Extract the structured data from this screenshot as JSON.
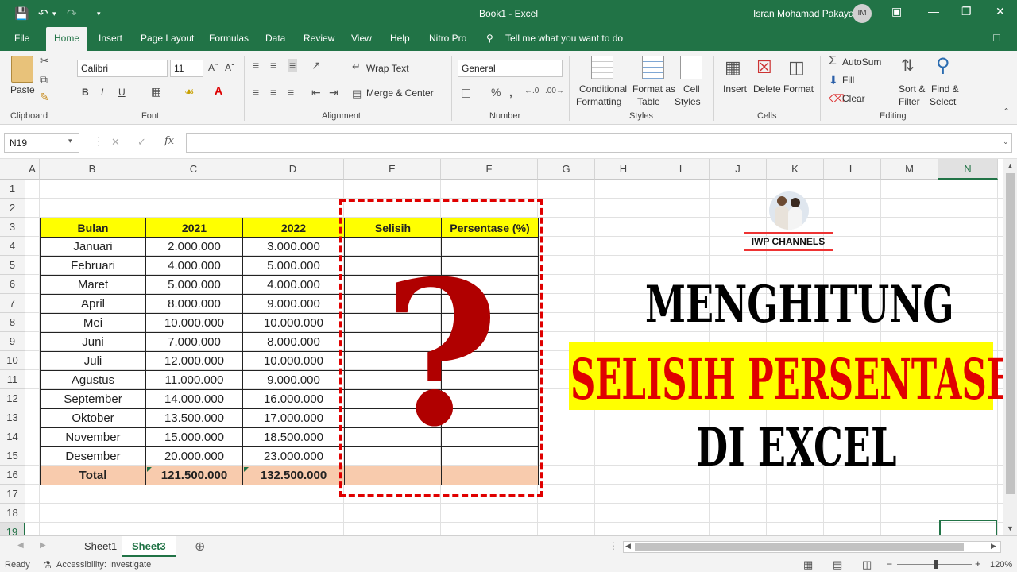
{
  "window": {
    "title": "Book1  -  Excel",
    "user_name": "Isran Mohamad Pakaya",
    "user_initials": "IM"
  },
  "menu_tabs": [
    "File",
    "Home",
    "Insert",
    "Page Layout",
    "Formulas",
    "Data",
    "Review",
    "View",
    "Help",
    "Nitro Pro"
  ],
  "tell_me": "Tell me what you want to do",
  "ribbon": {
    "clipboard": {
      "paste": "Paste",
      "label": "Clipboard"
    },
    "font": {
      "name": "Calibri",
      "size": "11",
      "label": "Font",
      "bold": "B",
      "italic": "I",
      "underline": "U"
    },
    "alignment": {
      "wrap_text": "Wrap Text",
      "merge_center": "Merge & Center",
      "label": "Alignment"
    },
    "number": {
      "format": "General",
      "label": "Number"
    },
    "styles": {
      "conditional": "Conditional",
      "formatting": "Formatting",
      "format_as": "Format as",
      "table": "Table",
      "cell": "Cell",
      "cell_styles": "Styles",
      "label": "Styles"
    },
    "cells": {
      "insert": "Insert",
      "delete": "Delete",
      "format": "Format",
      "label": "Cells"
    },
    "editing": {
      "autosum": "AutoSum",
      "fill": "Fill",
      "clear": "Clear",
      "sort": "Sort &",
      "filter": "Filter",
      "find": "Find &",
      "select": "Select",
      "label": "Editing"
    }
  },
  "formula_bar": {
    "name_box": "N19",
    "fx": "fx",
    "value": ""
  },
  "columns": [
    "A",
    "B",
    "C",
    "D",
    "E",
    "F",
    "G",
    "H",
    "I",
    "J",
    "K",
    "L",
    "M",
    "N"
  ],
  "rows": [
    "1",
    "2",
    "3",
    "4",
    "5",
    "6",
    "7",
    "8",
    "9",
    "10",
    "11",
    "12",
    "13",
    "14",
    "15",
    "16",
    "17",
    "18",
    "19"
  ],
  "table": {
    "headers": [
      "Bulan",
      "2021",
      "2022",
      "Selisih",
      "Persentase (%)"
    ],
    "rows": [
      [
        "Januari",
        "2.000.000",
        "3.000.000",
        "",
        ""
      ],
      [
        "Februari",
        "4.000.000",
        "5.000.000",
        "",
        ""
      ],
      [
        "Maret",
        "5.000.000",
        "4.000.000",
        "",
        ""
      ],
      [
        "April",
        "8.000.000",
        "9.000.000",
        "",
        ""
      ],
      [
        "Mei",
        "10.000.000",
        "10.000.000",
        "",
        ""
      ],
      [
        "Juni",
        "7.000.000",
        "8.000.000",
        "",
        ""
      ],
      [
        "Juli",
        "12.000.000",
        "10.000.000",
        "",
        ""
      ],
      [
        "Agustus",
        "11.000.000",
        "9.000.000",
        "",
        ""
      ],
      [
        "September",
        "14.000.000",
        "16.000.000",
        "",
        ""
      ],
      [
        "Oktober",
        "13.500.000",
        "17.000.000",
        "",
        ""
      ],
      [
        "November",
        "15.000.000",
        "18.500.000",
        "",
        ""
      ],
      [
        "Desember",
        "20.000.000",
        "23.000.000",
        "",
        ""
      ]
    ],
    "total": [
      "Total",
      "121.500.000",
      "132.500.000",
      "",
      ""
    ]
  },
  "overlay": {
    "question_mark": "?",
    "channel_name": "IWP CHANNELS",
    "line1": "MENGHITUNG",
    "line2": "SELISIH PERSENTASE",
    "line3": "DI EXCEL"
  },
  "sheets": [
    "Sheet1",
    "Sheet3"
  ],
  "active_sheet": "Sheet3",
  "status": {
    "ready": "Ready",
    "accessibility": "Accessibility: Investigate",
    "zoom": "120%"
  },
  "colors": {
    "excel_green": "#217346",
    "header_yellow": "#ffff00",
    "total_peach": "#f8cbad",
    "dash_red": "#e00000"
  }
}
